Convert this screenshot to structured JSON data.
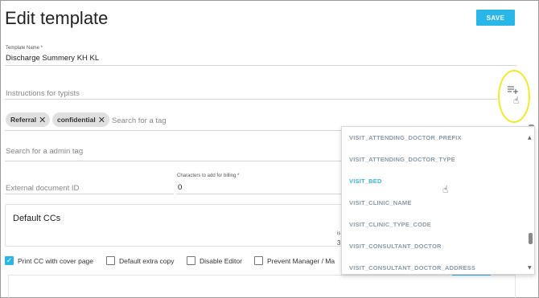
{
  "header": {
    "title": "Edit template",
    "save_label": "SAVE"
  },
  "template_name": {
    "label": "Template Name *",
    "value": "Discharge Summery KH KL"
  },
  "instructions": {
    "placeholder": "Instructions for typists",
    "icon": "add-list-icon"
  },
  "tags": {
    "chips": [
      {
        "label": "Referral"
      },
      {
        "label": "confidential"
      }
    ],
    "search_placeholder": "Search for a tag"
  },
  "admin_tag": {
    "placeholder": "Search for a admin tag"
  },
  "external_document": {
    "placeholder": "External document ID"
  },
  "billing": {
    "label": "Characters to add for billing *",
    "value": "0"
  },
  "default_ccs": {
    "title": "Default CCs",
    "partial_label": "is",
    "partial_value": "3"
  },
  "options": [
    {
      "label": "Print CC with cover page",
      "checked": true
    },
    {
      "label": "Default extra copy",
      "checked": false
    },
    {
      "label": "Disable Editor",
      "checked": false
    },
    {
      "label": "Prevent Manager / Ma",
      "checked": false
    }
  ],
  "dropdown": {
    "items": [
      {
        "label": "VISIT_ATTENDING_DOCTOR_PREFIX",
        "active": false
      },
      {
        "label": "VISIT_ATTENDING_DOCTOR_TYPE",
        "active": false
      },
      {
        "label": "VISIT_BED",
        "active": true
      },
      {
        "label": "VISIT_CLINIC_NAME",
        "active": false
      },
      {
        "label": "VISIT_CLINIC_TYPE_CODE",
        "active": false
      },
      {
        "label": "VISIT_CONSULTANT_DOCTOR",
        "active": false
      },
      {
        "label": "VISIT_CONSULTANT_DOCTOR_ADDRESS",
        "active": false
      }
    ]
  },
  "colors": {
    "accent": "#29b6e8",
    "highlight_ring": "#f3ea28",
    "dropdown_item": "#8a9aa8",
    "dropdown_active": "#3ab4dc"
  }
}
